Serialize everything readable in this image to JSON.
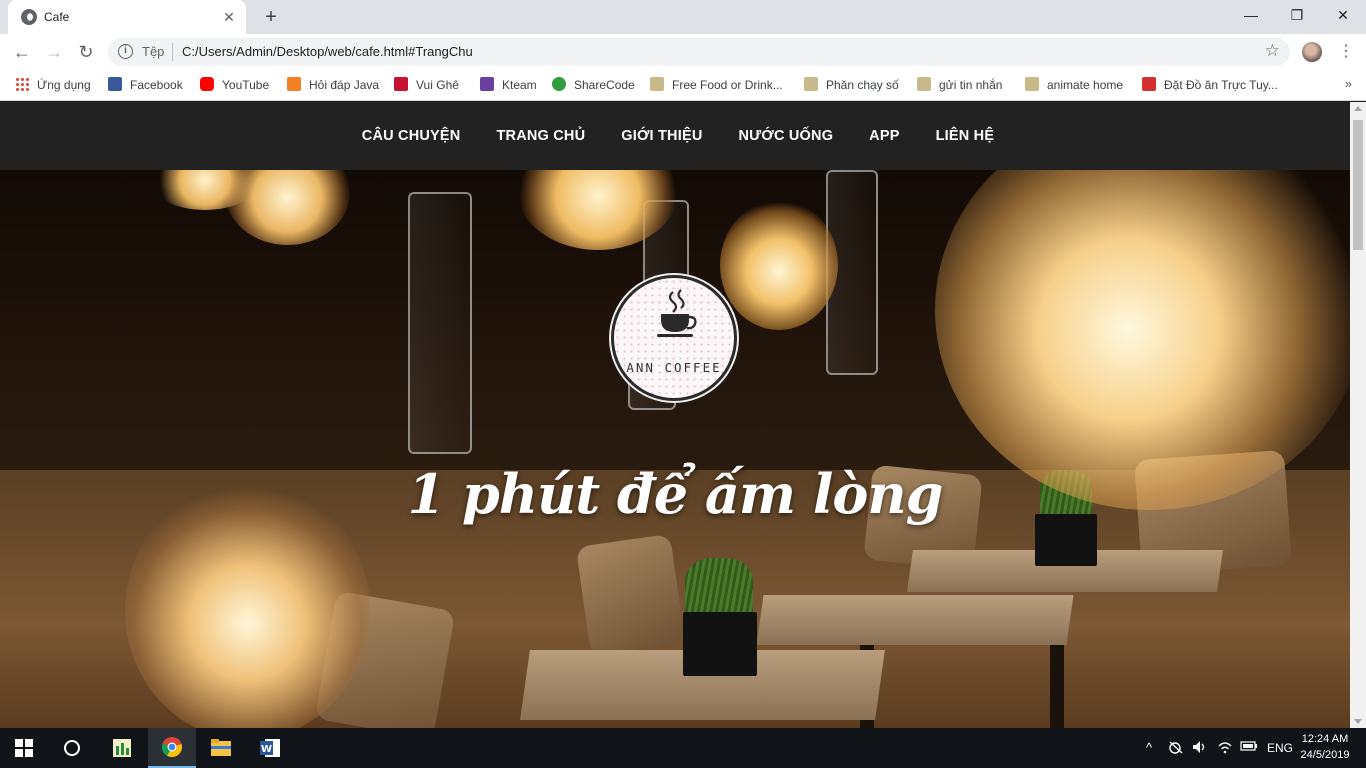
{
  "tab": {
    "title": "Cafe",
    "close": "✕"
  },
  "window": {
    "minimize": "—",
    "maximize": "❐",
    "close": "✕",
    "new_tab": "+"
  },
  "toolbar": {
    "back": "←",
    "forward": "→",
    "reload": "↻",
    "scheme_label": "Tệp",
    "url": "C:/Users/Admin/Desktop/web/cafe.html#TrangChu",
    "star": "☆",
    "menu": "⋮"
  },
  "bookmarks": {
    "items": [
      {
        "label": "Ứng dụng",
        "icon": "apps-grid-icon"
      },
      {
        "label": "Facebook",
        "icon": "facebook-icon",
        "color": "#3b5998"
      },
      {
        "label": "YouTube",
        "icon": "youtube-icon",
        "color": "#ff0000"
      },
      {
        "label": "Hỏi đáp Java",
        "icon": "stackoverflow-icon",
        "color": "#f48024"
      },
      {
        "label": "Vui Ghê",
        "icon": "play-icon",
        "color": "#c4122f"
      },
      {
        "label": "Kteam",
        "icon": "kteam-icon",
        "color": "#6a3fa0"
      },
      {
        "label": "ShareCode",
        "icon": "sharecode-icon",
        "color": "#2e9e3e"
      },
      {
        "label": "Free Food or Drink...",
        "icon": "folder-icon",
        "color": "#c8b98a"
      },
      {
        "label": "Phăn chạy số",
        "icon": "folder-icon",
        "color": "#c8b98a"
      },
      {
        "label": "gửi tin nhắn",
        "icon": "folder-icon",
        "color": "#c8b98a"
      },
      {
        "label": "animate home",
        "icon": "folder-icon",
        "color": "#c8b98a"
      },
      {
        "label": "Đặt Đồ ăn Trực Tuy...",
        "icon": "bookmark-red-icon",
        "color": "#d62f2f"
      }
    ],
    "more": "»"
  },
  "site": {
    "nav": [
      "CÂU CHUYỆN",
      "TRANG CHỦ",
      "GIỚI THIỆU",
      "NƯỚC UỐNG",
      "APP",
      "LIÊN HỆ"
    ],
    "logo_text": "ANN COFFEE",
    "tagline": "1 phút để ấm lòng"
  },
  "taskbar": {
    "items": [
      "windows-start-icon",
      "cortana-circle-icon",
      "app-green-icon",
      "chrome-icon",
      "file-explorer-icon",
      "word-icon"
    ],
    "tray": {
      "chevron": "^",
      "language": "ENG"
    },
    "time": "12:24 AM",
    "date": "24/5/2019"
  }
}
